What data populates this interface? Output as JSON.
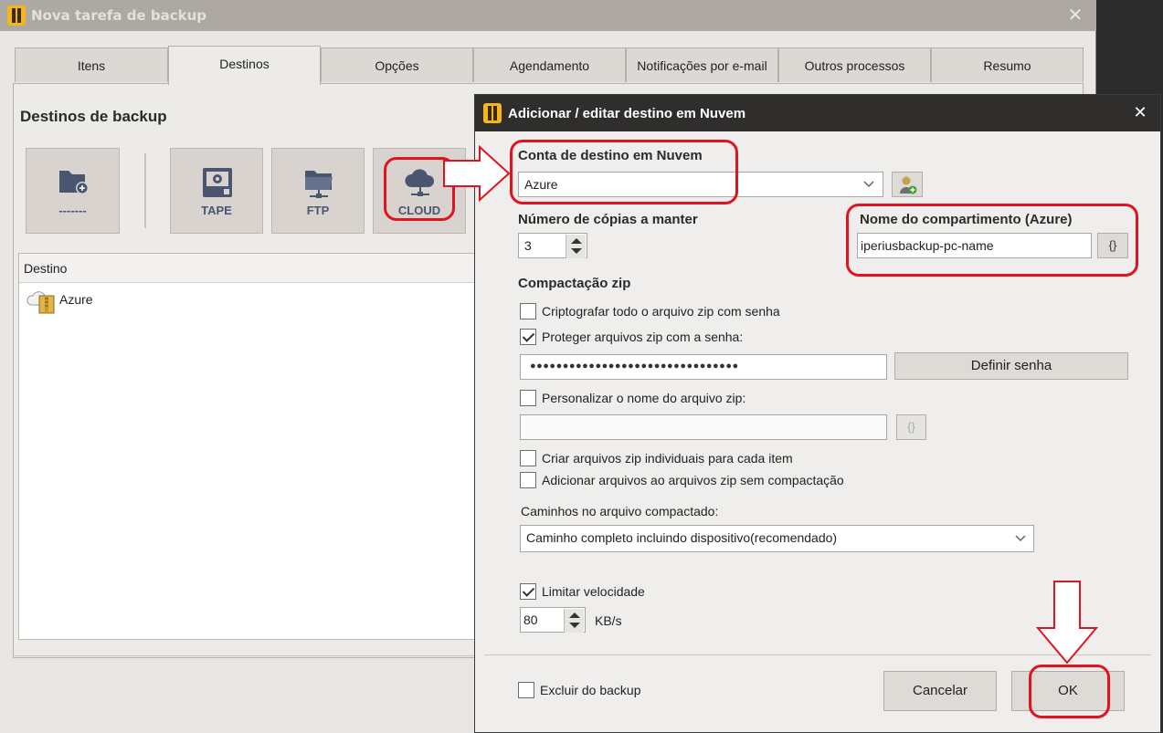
{
  "main_window": {
    "title": "Nova tarefa de backup",
    "close_label": "✕",
    "tabs": [
      {
        "label": "Itens",
        "active": false
      },
      {
        "label": "Destinos",
        "active": true
      },
      {
        "label": "Opções",
        "active": false
      },
      {
        "label": "Agendamento",
        "active": false
      },
      {
        "label": "Notificações por e-mail",
        "active": false
      },
      {
        "label": "Outros processos",
        "active": false
      },
      {
        "label": "Resumo",
        "active": false
      }
    ],
    "heading": "Destinos de backup",
    "destination_buttons": [
      {
        "label": "-------",
        "icon": "folder-add-icon"
      },
      {
        "label": "TAPE",
        "icon": "tape-icon"
      },
      {
        "label": "FTP",
        "icon": "ftp-folder-icon"
      },
      {
        "label": "CLOUD",
        "icon": "cloud-icon"
      }
    ],
    "list": {
      "header": "Destino",
      "items": [
        {
          "label": "Azure",
          "icon": "cloud-zip-icon"
        }
      ]
    }
  },
  "dialog": {
    "title": "Adicionar / editar destino em Nuvem",
    "close_label": "✕",
    "cloud_account": {
      "label": "Conta de destino em Nuvem",
      "value": "Azure"
    },
    "copies": {
      "label": "Número de cópias a manter",
      "value": "3"
    },
    "container": {
      "label": "Nome do compartimento (Azure)",
      "value": "iperiusbackup-pc-name",
      "var_button": "{}"
    },
    "zip_section": "Compactação zip",
    "encrypt_zip": {
      "label": "Criptografar todo o arquivo zip com senha",
      "checked": false
    },
    "protect_zip": {
      "label": "Proteger arquivos zip com a senha:",
      "checked": true
    },
    "password_value": "●●●●●●●●●●●●●●●●●●●●●●●●●●●●●●●●",
    "set_password_button": "Definir senha",
    "custom_name": {
      "label": "Personalizar o nome do arquivo zip:",
      "checked": false,
      "value": "",
      "var_button": "{}"
    },
    "individual_zip": {
      "label": "Criar arquivos zip individuais para cada item",
      "checked": false
    },
    "no_compression": {
      "label": "Adicionar arquivos ao arquivos zip sem compactação",
      "checked": false
    },
    "paths_label": "Caminhos no arquivo compactado:",
    "paths_value": "Caminho completo incluindo dispositivo(recomendado)",
    "limit_speed": {
      "label": "Limitar velocidade",
      "checked": true
    },
    "speed": {
      "value": "80",
      "unit": "KB/s"
    },
    "exclude": {
      "label": "Excluir do backup",
      "checked": false
    },
    "cancel_button": "Cancelar",
    "ok_button": "OK"
  },
  "colors": {
    "annotation": "#e0141e",
    "accent_logo": "#f5b61a",
    "icon_blue": "#4a5570"
  }
}
